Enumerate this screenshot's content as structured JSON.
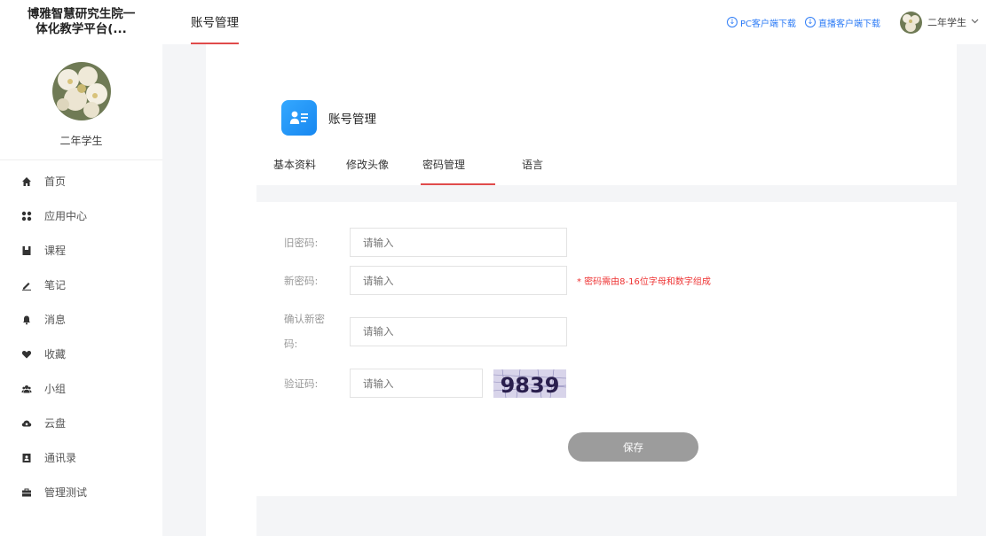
{
  "brand": {
    "line1": "博雅智慧研究生院一",
    "line2": "体化教学平台(..."
  },
  "profile": {
    "username": "二年学生"
  },
  "sidebar": {
    "items": [
      {
        "label": "首页",
        "icon": "home-icon"
      },
      {
        "label": "应用中心",
        "icon": "apps-icon"
      },
      {
        "label": "课程",
        "icon": "course-icon"
      },
      {
        "label": "笔记",
        "icon": "note-icon"
      },
      {
        "label": "消息",
        "icon": "bell-icon"
      },
      {
        "label": "收藏",
        "icon": "heart-icon"
      },
      {
        "label": "小组",
        "icon": "group-icon"
      },
      {
        "label": "云盘",
        "icon": "cloud-icon"
      },
      {
        "label": "通讯录",
        "icon": "contacts-icon"
      },
      {
        "label": "管理测试",
        "icon": "briefcase-icon"
      }
    ]
  },
  "header": {
    "tab": "账号管理",
    "pc_download": "PC客户端下载",
    "live_download": "直播客户端下载",
    "user": "二年学生"
  },
  "page": {
    "title": "账号管理",
    "tabs": [
      "基本资料",
      "修改头像",
      "密码管理",
      "语言"
    ],
    "active_tab": "密码管理"
  },
  "form": {
    "old_password_label": "旧密码:",
    "new_password_label": "新密码:",
    "confirm_label_1": "确认新密",
    "confirm_label_2": "码:",
    "captcha_label": "验证码:",
    "placeholder": "请输入",
    "password_hint": "* 密码需由8-16位字母和数字组成",
    "captcha_text": "9839",
    "save_label": "保存"
  },
  "colors": {
    "accent_red": "#e04b4b",
    "link_blue": "#2e7cf6",
    "button_gray": "#9c9c9c",
    "hint_red": "#e33"
  }
}
